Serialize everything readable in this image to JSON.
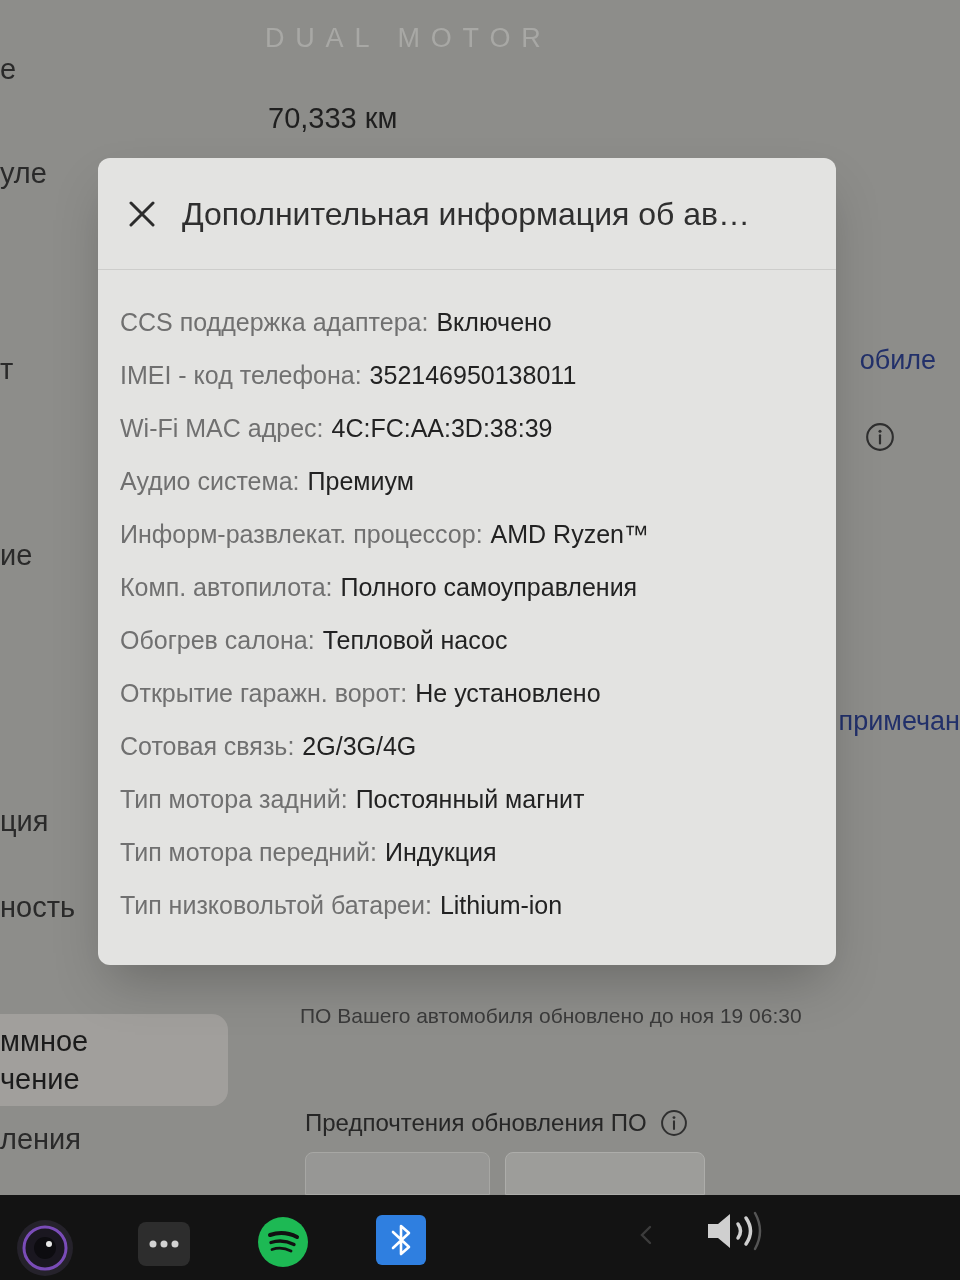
{
  "sidebar": {
    "items": [
      {
        "lines": [
          "е"
        ],
        "selected": false
      },
      {
        "lines": [
          "уле"
        ],
        "selected": false
      },
      {
        "lines": [
          "т"
        ],
        "selected": false
      },
      {
        "lines": [
          "ие"
        ],
        "selected": false
      },
      {
        "lines": [
          "ция"
        ],
        "selected": false
      },
      {
        "lines": [
          "ность"
        ],
        "selected": false
      },
      {
        "lines": [
          "ммное",
          "чение"
        ],
        "selected": true
      },
      {
        "lines": [
          "ления"
        ],
        "selected": false
      }
    ]
  },
  "vehicle": {
    "badge": "DUAL MOTOR",
    "odometer": "70,333 км"
  },
  "links": [
    "обиле",
    "примечан"
  ],
  "software": {
    "update_status": "ПО Вашего автомобиля обновлено до ноя 19 06:30",
    "preferences_title": "Предпочтения обновления ПО"
  },
  "modal": {
    "title": "Дополнительная информация об ав…",
    "rows": [
      {
        "label": "CCS поддержка адаптера:",
        "value": "Включено"
      },
      {
        "label": "IMEI - код телефона:",
        "value": "352146950138011"
      },
      {
        "label": "Wi-Fi MAC адрес:",
        "value": "4C:FC:AA:3D:38:39"
      },
      {
        "label": "Аудио система:",
        "value": "Премиум"
      },
      {
        "label": "Информ-развлекат. процессор:",
        "value": "AMD Ryzen™"
      },
      {
        "label": "Комп. автопилота:",
        "value": "Полного самоуправления"
      },
      {
        "label": "Обогрев салона:",
        "value": "Тепловой насос"
      },
      {
        "label": "Открытие гаражн. ворот:",
        "value": "Не установлено"
      },
      {
        "label": "Сотовая связь:",
        "value": "2G/3G/4G"
      },
      {
        "label": "Тип мотора задний:",
        "value": "Постоянный магнит"
      },
      {
        "label": "Тип мотора передний:",
        "value": "Индукция"
      },
      {
        "label": "Тип низковольтой батареи:",
        "value": "Lithium-ion"
      }
    ]
  }
}
